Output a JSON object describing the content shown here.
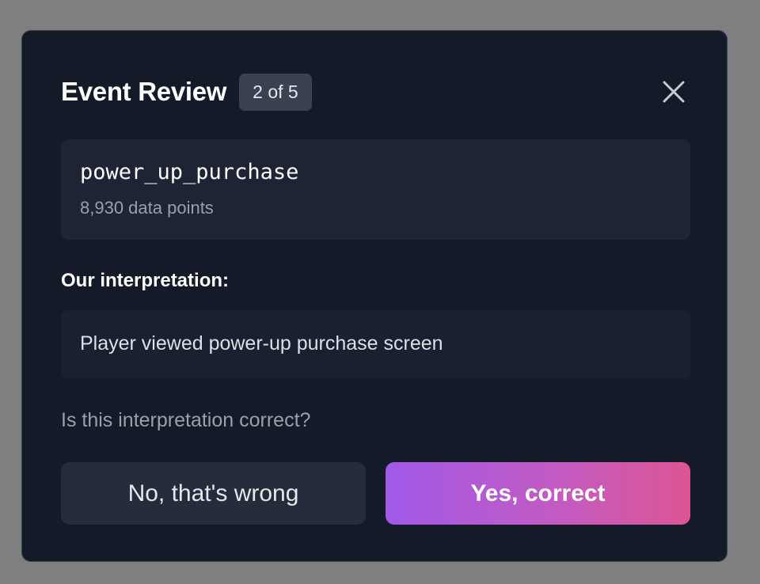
{
  "modal": {
    "title": "Event Review",
    "progress_badge": "2 of 5",
    "close_icon": "close-icon"
  },
  "event": {
    "name": "power_up_purchase",
    "data_points": "8,930 data points"
  },
  "interpretation": {
    "label": "Our interpretation:",
    "text": "Player viewed power-up purchase screen"
  },
  "question": "Is this interpretation correct?",
  "buttons": {
    "no_label": "No, that's wrong",
    "yes_label": "Yes, correct"
  },
  "colors": {
    "overlay": "#7f7f7f",
    "modal_bg": "#141a28",
    "card_bg": "#1e2433",
    "gradient_start": "#a05ae8",
    "gradient_end": "#dd5694"
  }
}
